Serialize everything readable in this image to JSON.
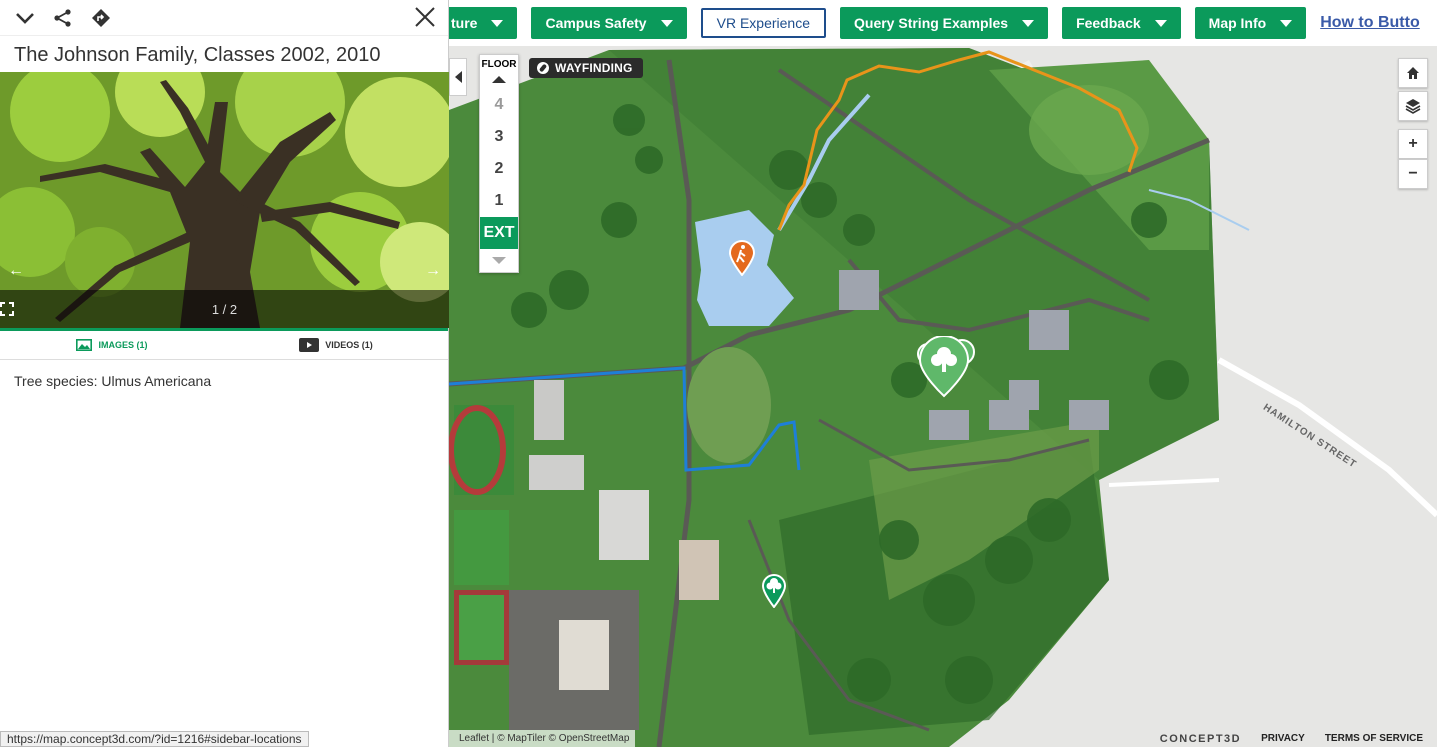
{
  "nav": {
    "partial_first_label": "ture",
    "campus_safety_label": "Campus Safety",
    "vr_label": "VR Experience",
    "query_label": "Query String Examples",
    "feedback_label": "Feedback",
    "map_info_label": "Map Info",
    "how_to_label": "How to Butto"
  },
  "floor_selector": {
    "title": "FLOOR",
    "floors": [
      "4",
      "3",
      "2",
      "1",
      "EXT"
    ],
    "active_floor": "EXT"
  },
  "wayfinding": {
    "label": "WAYFINDING"
  },
  "map": {
    "street_label": "HAMILTON STREET",
    "controls": {
      "home_icon": "home-icon",
      "layers_icon": "layers-icon",
      "zoom_in": "+",
      "zoom_out": "−"
    },
    "markers": [
      "hiking-marker",
      "tree-cluster-marker",
      "tree-marker"
    ],
    "colors": {
      "accent": "#0b9a5b",
      "trail_orange": "#e8941a",
      "route_blue": "#1e7fd8",
      "grass": "#4b8a3c",
      "water": "#a9cdef"
    }
  },
  "attribution": {
    "leaflet": "Leaflet",
    "maptiler": "© MapTiler",
    "osm": "© OpenStreetMap",
    "brand": "CONCEPT3D",
    "privacy": "PRIVACY",
    "terms": "TERMS OF SERVICE"
  },
  "sidebar": {
    "title": "The Johnson Family, Classes 2002, 2010",
    "photo_counter": "1 / 2",
    "tabs": {
      "images": "IMAGES (1)",
      "videos": "VIDEOS (1)"
    },
    "description": "Tree species: Ulmus Americana"
  },
  "status_url": "https://map.concept3d.com/?id=1216#sidebar-locations"
}
